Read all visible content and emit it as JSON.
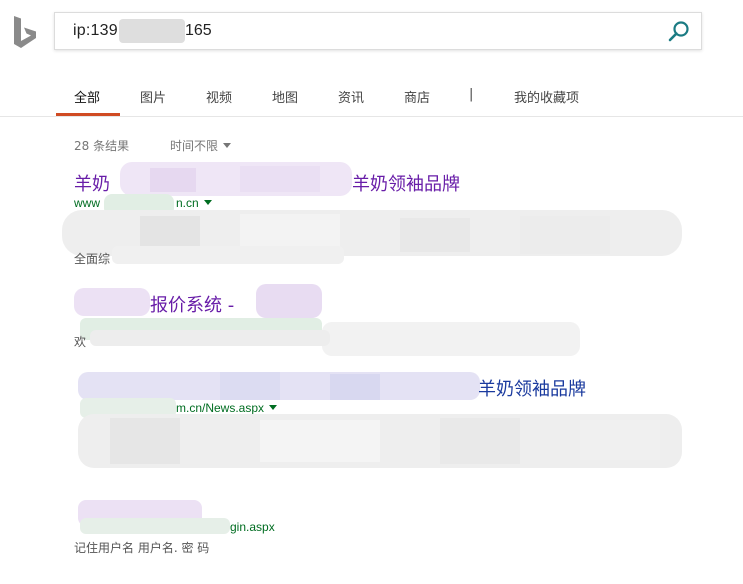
{
  "search": {
    "query_prefix": "ip:139",
    "query_suffix": "165"
  },
  "tabs": [
    {
      "label": "全部"
    },
    {
      "label": "图片"
    },
    {
      "label": "视频"
    },
    {
      "label": "地图"
    },
    {
      "label": "资讯"
    },
    {
      "label": "商店"
    },
    {
      "label": "|"
    },
    {
      "label": "我的收藏项"
    }
  ],
  "results_meta": {
    "count": "28 条结果",
    "time_filter": "时间不限"
  },
  "results": [
    {
      "title_left": "羊奶",
      "title_right": "羊奶领袖品牌",
      "url_left": "www",
      "url_right": "n.cn",
      "snippet_fragment": "全面综"
    },
    {
      "title_main": "报价系统 -",
      "snippet_fragment": "欢"
    },
    {
      "title_right": "羊奶领袖品牌",
      "url_right": "m.cn/News.aspx"
    },
    {
      "url_right": "gin.aspx",
      "snippet": "记住用户名 用户名. 密 码"
    }
  ],
  "colors": {
    "accent": "#d04b23",
    "visited_link": "#681da8",
    "link": "#1a3a9e",
    "url_green": "#006d21",
    "search_icon": "#1b7b83"
  }
}
